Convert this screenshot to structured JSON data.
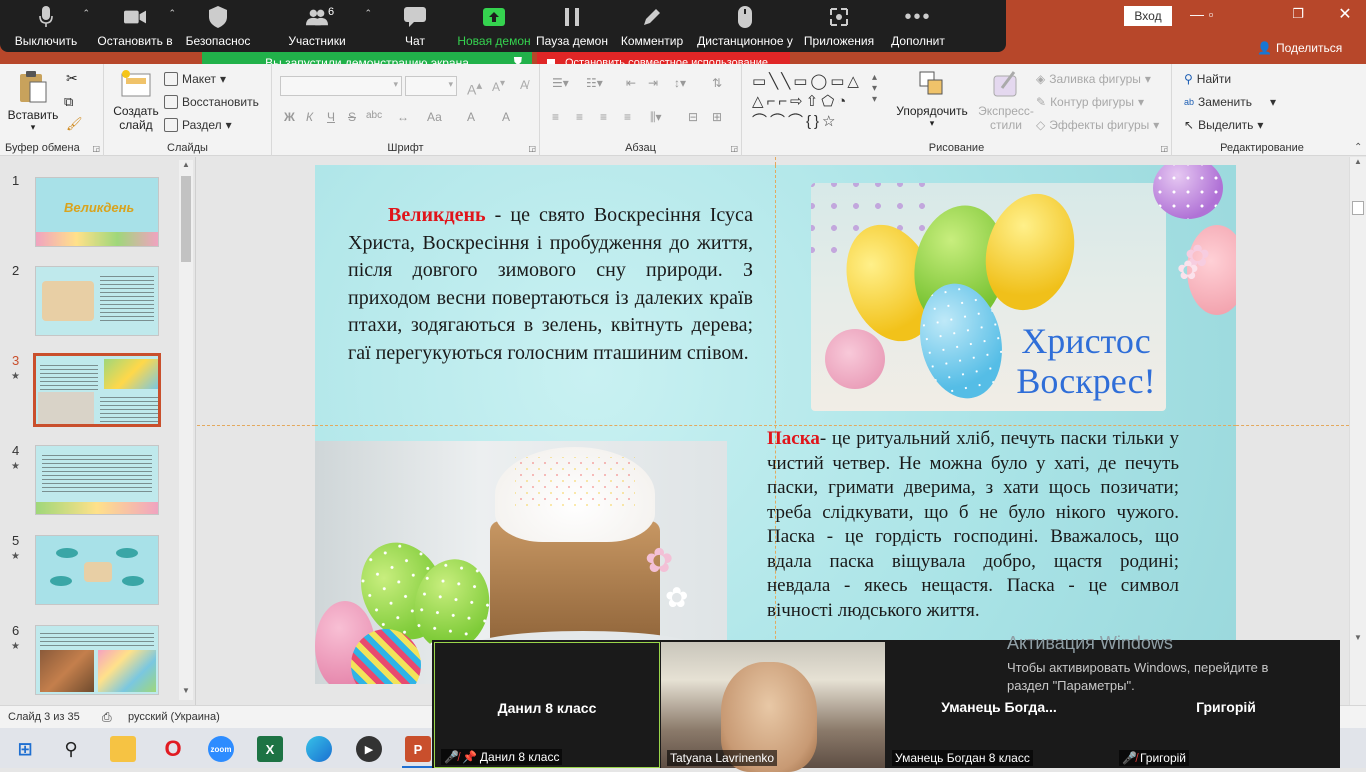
{
  "zoom_toolbar": {
    "mute_label": "Выключить",
    "video_label": "Остановить в",
    "security_label": "Безопаснос",
    "participants_label": "Участники",
    "participants_count": "6",
    "chat_label": "Чат",
    "new_share_label": "Новая демон",
    "pause_share_label": "Пауза демон",
    "annotate_label": "Комментир",
    "remote_control_label": "Дистанционное у",
    "apps_label": "Приложения",
    "more_label": "Дополнит",
    "sharing_notice": "Вы запустили демонстрацию экрана",
    "stop_share_label": "Остановить совместное использование"
  },
  "window": {
    "signin_label": "Вход",
    "share_label": "Поделиться"
  },
  "ribbon": {
    "clipboard": {
      "paste": "Вставить",
      "group": "Буфер обмена"
    },
    "slides": {
      "new_slide_line1": "Создать",
      "new_slide_line2": "слайд",
      "layout": "Макет",
      "reset": "Восстановить",
      "section": "Раздел",
      "group": "Слайды"
    },
    "font": {
      "group": "Шрифт",
      "bold": "Ж",
      "italic": "К",
      "underline": "Ч",
      "strike": "S",
      "spacing": "abc",
      "font_color": "A",
      "highlight": "A",
      "case": "Аа"
    },
    "paragraph": {
      "group": "Абзац"
    },
    "drawing": {
      "arrange_label": "Упорядочить",
      "quick_styles_line1": "Экспресс-",
      "quick_styles_line2": "стили",
      "shape_fill": "Заливка фигуры",
      "shape_outline": "Контур фигуры",
      "shape_effects": "Эффекты фигуры",
      "group": "Рисование"
    },
    "editing": {
      "find": "Найти",
      "replace": "Заменить",
      "select": "Выделить",
      "group": "Редактирование"
    }
  },
  "thumbnails": [
    {
      "num": "1",
      "star": "",
      "title": "Великдень"
    },
    {
      "num": "2",
      "star": "",
      "title": ""
    },
    {
      "num": "3",
      "star": "★",
      "title": ""
    },
    {
      "num": "4",
      "star": "★",
      "title": ""
    },
    {
      "num": "5",
      "star": "★",
      "title": ""
    },
    {
      "num": "6",
      "star": "★",
      "title": ""
    }
  ],
  "slide": {
    "p1_lead": "Великдень",
    "p1_rest": " - це свято Воскресіння Ісуса Христа, Воскресіння і пробудження до життя, після довгого зимового сну природи. З приходом весни повертаються із далеких країв птахи, зодягаються в зелень, квітнуть дерева; гаї перегукуються голосним пташиним співом.",
    "card_line1": "Христос",
    "card_line2": "Воскрес!",
    "p2_lead": "Паска",
    "p2_rest": "- це ритуальний хліб, печуть паски тільки у чистий четвер. Не можна було у хаті, де печуть паски, гримати дверима, з хати щось позичати; треба слідкувати, що б не було нікого чужого. Паска - це гордість господині. Вважалось, що вдала паска віщувала добро, щастя родині; невдала - якесь нещастя. Паска - це символ вічності людського життя."
  },
  "statusbar": {
    "slide_info": "Слайд 3 из 35",
    "language": "русский (Украина)"
  },
  "gallery": [
    {
      "name": "Данил 8 класс",
      "label": "Данил 8 класс",
      "muted": true
    },
    {
      "name": "",
      "label": "Tatyana Lavrinenko",
      "muted": false
    },
    {
      "name": "Уманець Богда...",
      "label": "Уманець Богдан 8 класс",
      "muted": false
    },
    {
      "name": "Григорій",
      "label": "Григорій",
      "muted": true
    }
  ],
  "activation": {
    "title": "Активация Windows",
    "body_line1": "Чтобы активировать Windows, перейдите в",
    "body_line2": "раздел \"Параметры\"."
  },
  "taskbar": {
    "zoom_label": "zoom"
  },
  "colors": {
    "powerpoint_accent": "#b7472a",
    "zoom_toolbar_bg": "#1f1f1f",
    "share_green": "#21b14a",
    "stop_red": "#e02626",
    "slide_bg": "#a9e3e6",
    "heading_red": "#e0151b"
  }
}
